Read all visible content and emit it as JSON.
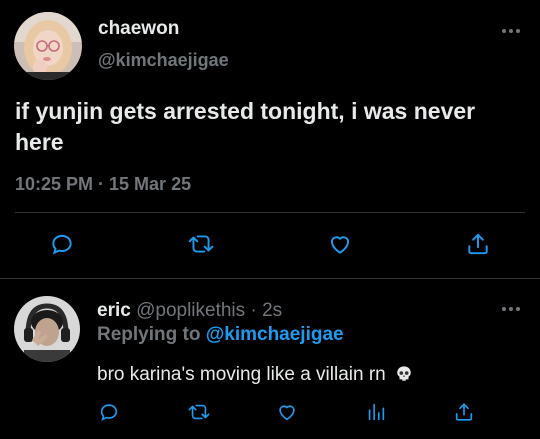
{
  "main": {
    "display_name": "chaewon",
    "handle": "@kimchaejigae",
    "text": "if yunjin gets arrested tonight, i was never here",
    "timestamp": "10:25 PM · 15 Mar 25",
    "avatar_icon": "profile-photo",
    "more_icon": "more-horizontal-icon",
    "actions": [
      "reply-icon",
      "retweet-icon",
      "like-icon",
      "share-icon"
    ]
  },
  "reply": {
    "display_name": "eric",
    "handle": "@poplikethis",
    "separator": "·",
    "time": "2s",
    "replying_label": "Replying to",
    "replying_to": "@kimchaejigae",
    "text": "bro karina's moving like a villain rn",
    "emoji_icon": "skull-emoji",
    "more_icon": "more-horizontal-icon",
    "actions": [
      "reply-icon",
      "retweet-icon",
      "like-icon",
      "analytics-icon",
      "share-icon"
    ]
  },
  "colors": {
    "background": "#000000",
    "text": "#e7e9ea",
    "muted": "#71767b",
    "link": "#1d9bf0",
    "divider": "#2f3336"
  }
}
